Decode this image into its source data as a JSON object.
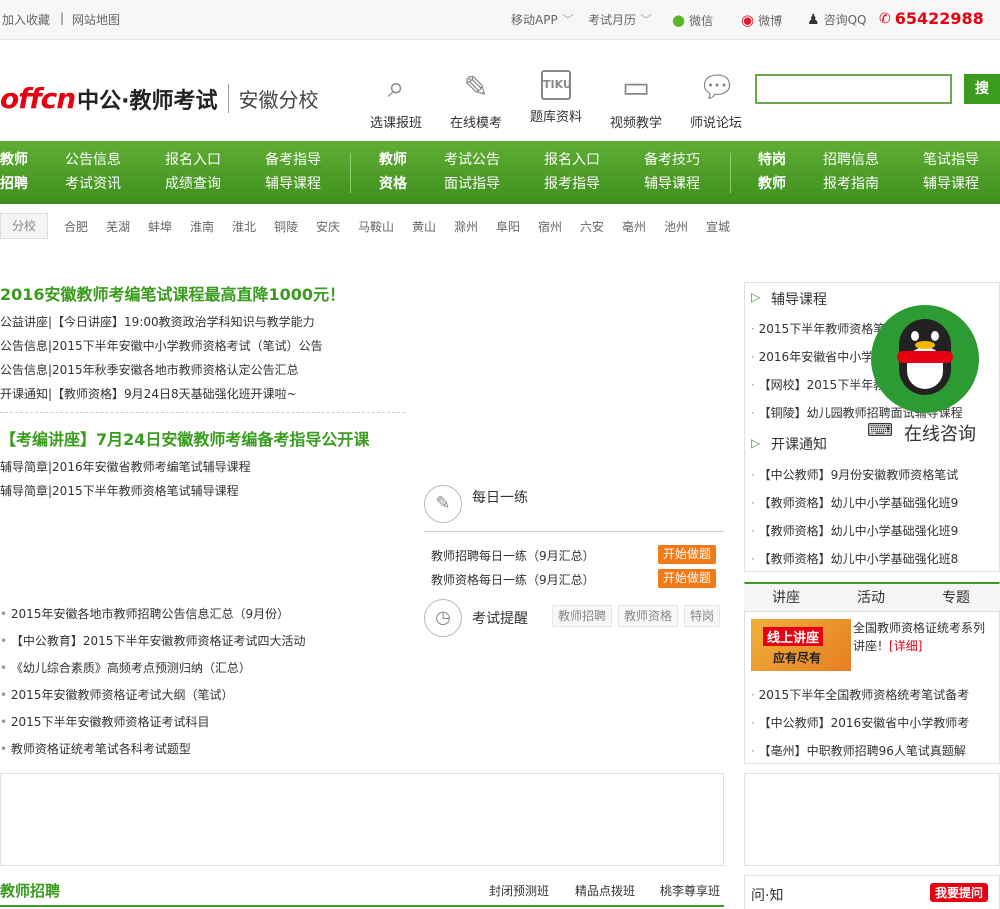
{
  "topbar": {
    "favorites": "加入收藏",
    "sitemap": "网站地图",
    "mobile_app": "移动APP",
    "exam_calendar": "考试月历",
    "wechat": "微信",
    "weibo": "微博",
    "qq_consult": "咨询QQ",
    "phone": "65422988"
  },
  "header": {
    "logo_offcn": "offcn",
    "logo_brand": "中公·教师考试",
    "branch": "安徽分校",
    "nav": [
      {
        "label": "选课报班",
        "icon": "search-icon"
      },
      {
        "label": "在线模考",
        "icon": "pencil-icon"
      },
      {
        "label": "题库资料",
        "icon": "tiku-icon"
      },
      {
        "label": "视频教学",
        "icon": "video-icon"
      },
      {
        "label": "师说论坛",
        "icon": "chat-icon"
      }
    ],
    "search_button": "搜"
  },
  "greennav": {
    "g1": {
      "cat1": "教师",
      "cat2": "招聘",
      "c1a": "公告信息",
      "c1b": "考试资讯",
      "c2a": "报名入口",
      "c2b": "成绩查询",
      "c3a": "备考指导",
      "c3b": "辅导课程"
    },
    "g2": {
      "cat1": "教师",
      "cat2": "资格",
      "c1a": "考试公告",
      "c1b": "面试指导",
      "c2a": "报名入口",
      "c2b": "报考指导",
      "c3a": "备考技巧",
      "c3b": "辅导课程"
    },
    "g3": {
      "cat1": "特岗",
      "cat2": "教师",
      "c1a": "招聘信息",
      "c1b": "报考指南",
      "c2a": "笔试指导",
      "c2b": "辅导课程"
    }
  },
  "branches": {
    "label": "分校",
    "cities": [
      "合肥",
      "芜湖",
      "蚌埠",
      "淮南",
      "淮北",
      "铜陵",
      "安庆",
      "马鞍山",
      "黄山",
      "滁州",
      "阜阳",
      "宿州",
      "六安",
      "亳州",
      "池州",
      "宣城"
    ]
  },
  "main": {
    "headline1": "2016安徽教师考编笔试课程最高直降1000元！",
    "news1": [
      "公益讲座|【今日讲座】19:00教资政治学科知识与教学能力",
      "公告信息|2015下半年安徽中小学教师资格考试（笔试）公告",
      "公告信息|2015年秋季安徽各地市教师资格认定公告汇总",
      "开课通知|【教师资格】9月24日8天基础强化班开课啦~"
    ],
    "headline2": "【考编讲座】7月24日安徽教师考编备考指导公开课",
    "news2": [
      "辅导简章|2016年安徽省教师考编笔试辅导课程",
      "辅导简章|2015下半年教师资格笔试辅导课程"
    ],
    "daily": {
      "title": "每日一练",
      "items": [
        "教师招聘每日一练（9月汇总）",
        "教师资格每日一练（9月汇总）"
      ],
      "btn": "开始做题"
    },
    "remind": {
      "title": "考试提醒",
      "tags": [
        "教师招聘",
        "教师资格",
        "特岗"
      ]
    },
    "news3": [
      "2015年安徽各地市教师招聘公告信息汇总（9月份）",
      "【中公教育】2015下半年安徽教师资格证考试四大活动",
      "《幼儿综合素质》高频考点预测归纳（汇总）",
      "2015年安徽教师资格证考试大纲（笔试）",
      "2015下半年安徽教师资格证考试科目",
      "教师资格证统考笔试各科考试题型"
    ],
    "section_title": "教师招聘",
    "section_tabs": [
      "封闭预测班",
      "精品点拨班",
      "桃李尊享班"
    ]
  },
  "right": {
    "courses_title": "辅导课程",
    "courses": [
      "2015下半年教师资格笔试",
      "2016年安徽省中小学教师招聘",
      "【网校】2015下半年教师资格网",
      "【铜陵】幼儿园教师招聘面试辅导课程"
    ],
    "open_title": "开课通知",
    "open": [
      "【中公教师】9月份安徽教师资格笔试",
      "【教师资格】幼儿中小学基础强化班9",
      "【教师资格】幼儿中小学基础强化班9",
      "【教师资格】幼儿中小学基础强化班8"
    ],
    "tabs": [
      "讲座",
      "活动",
      "专题"
    ],
    "banner_line1": "线上讲座",
    "banner_line2": "应有尽有",
    "lecture_text": "全国教师资格证统考系列讲座！",
    "detail": "[详细]",
    "lectures": [
      "2015下半年全国教师资格统考笔试备考",
      "【中公教师】2016安徽省中小学教师考",
      "【亳州】中职教师招聘96人笔试真题解"
    ],
    "qa_title": "问·知",
    "ask_btn": "我要提问",
    "online_consult": "在线咨询"
  },
  "colors": {
    "brand_red": "#e60012",
    "brand_green": "#3a9c1f",
    "accent_orange": "#f47a18"
  }
}
